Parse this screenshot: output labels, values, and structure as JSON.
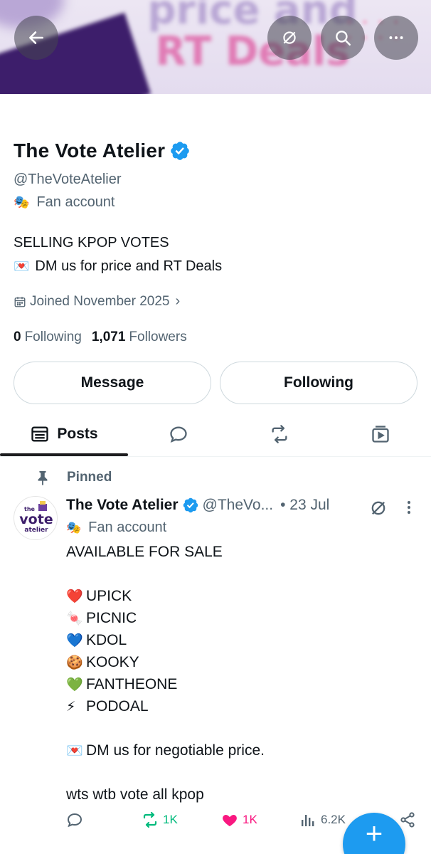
{
  "banner": {
    "line1": "price and",
    "line2": "RT Deals"
  },
  "header": {
    "back_icon": "arrow-left-icon",
    "translate_icon": "unmute-slash-icon",
    "search_icon": "search-icon",
    "more_icon": "more-horizontal-icon"
  },
  "profile": {
    "name": "The Vote Atelier",
    "handle": "@TheVoteAtelier",
    "label": "Fan account",
    "bio_line1": "SELLING KPOP VOTES",
    "bio_line2": "DM us for price and RT Deals",
    "joined": "Joined November 2025",
    "following_count": "0",
    "following_label": "Following",
    "followers_count": "1,071",
    "followers_label": "Followers",
    "verified_color": "#1d9bf0"
  },
  "buttons": {
    "message": "Message",
    "following": "Following"
  },
  "tabs": {
    "posts": "Posts"
  },
  "tweet": {
    "pinned": "Pinned",
    "name": "The Vote Atelier",
    "handle": "@TheVo...",
    "date": "• 23 Jul",
    "label": "Fan account",
    "avatar": {
      "the": "the",
      "vote": "vote",
      "atelier": "atelier"
    },
    "lines": [
      {
        "emoji": "",
        "text": "AVAILABLE FOR SALE"
      },
      {
        "emoji": "",
        "text": ""
      },
      {
        "emoji": "❤️",
        "text": "UPICK"
      },
      {
        "emoji": "🍬",
        "text": "PICNIC"
      },
      {
        "emoji": "💙",
        "text": "KDOL"
      },
      {
        "emoji": "🍪",
        "text": "KOOKY"
      },
      {
        "emoji": "💚",
        "text": "FANTHEONE"
      },
      {
        "emoji": "⚡",
        "text": "PODOAL"
      },
      {
        "emoji": "",
        "text": ""
      },
      {
        "emoji": "💌",
        "text": "DM us for negotiable price."
      },
      {
        "emoji": "",
        "text": ""
      },
      {
        "emoji": "",
        "text": "wts wtb vote all kpop"
      }
    ],
    "retweets": "1K",
    "likes": "1K",
    "views": "6.2K"
  },
  "colors": {
    "retweet": "#00ba7c",
    "like": "#f91880",
    "fab": "#1d9bf0"
  }
}
